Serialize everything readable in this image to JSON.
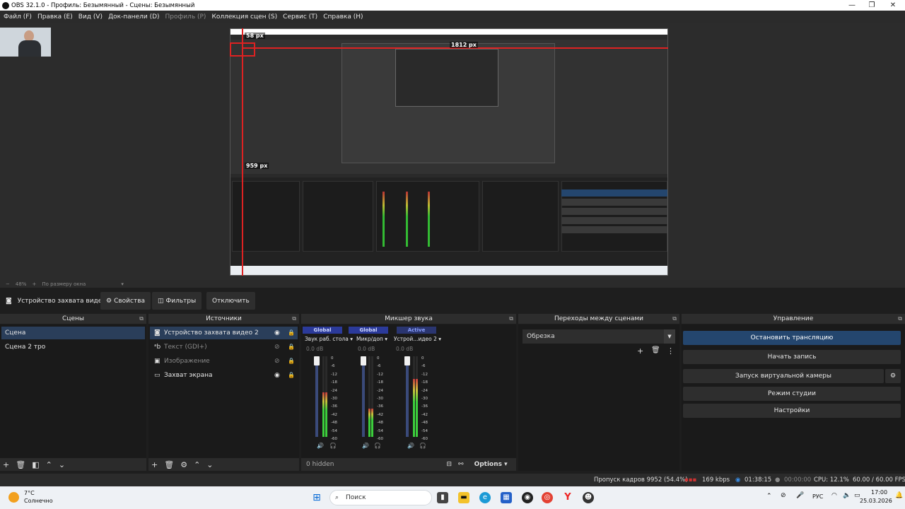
{
  "window": {
    "title": "OBS 32.1.0 - Профиль: Безымянный - Сцены: Безымянный"
  },
  "menu": [
    "Файл (F)",
    "Правка (E)",
    "Вид (V)",
    "Док-панели (D)",
    "Профиль (P)",
    "Коллекция сцен (S)",
    "Сервис (T)",
    "Справка (H)"
  ],
  "preview": {
    "label_top": "58 px",
    "label_right": "1812 px",
    "label_left": "959 px",
    "zoom": "48%",
    "zoom_mode": "По размеру окна"
  },
  "source_toolbar": {
    "source_name": "Устройство захвата видео",
    "properties": "Свойства",
    "filters": "Фильтры",
    "deactivate": "Отключить"
  },
  "scenes": {
    "title": "Сцены",
    "items": [
      "Сцена",
      "Сцена 2  тро"
    ]
  },
  "sources": {
    "title": "Источники",
    "items": [
      "Устройство захвата видео 2",
      "Текст (GDI+)",
      "Изображение",
      "Захват экрана"
    ]
  },
  "mixer": {
    "title": "Микшер звука",
    "channels": [
      {
        "badge": "Global",
        "name": "Звук раб. стола",
        "db": "0.0 dB",
        "level": 0.55
      },
      {
        "badge": "Global",
        "name": "Микр/доп",
        "db": "0.0 dB",
        "level": 0.35
      },
      {
        "badge": "Active",
        "name": "Устрой...идео 2",
        "db": "0.0 dB",
        "level": 0.72
      }
    ],
    "scale": [
      "0",
      "-6",
      "-12",
      "-18",
      "-24",
      "-30",
      "-36",
      "-42",
      "-48",
      "-54",
      "-60"
    ],
    "hidden": "0 hidden",
    "options": "Options"
  },
  "transitions": {
    "title": "Переходы между сценами",
    "selected": "Обрезка"
  },
  "controls": {
    "title": "Управление",
    "stop_stream": "Остановить трансляцию",
    "start_record": "Начать запись",
    "virtual_cam": "Запуск виртуальной камеры",
    "studio_mode": "Режим студии",
    "settings": "Настройки"
  },
  "status": {
    "dropped": "Пропуск кадров 9952 (54.4%)",
    "bitrate": "169 kbps",
    "stream_time": "01:38:15",
    "rec_time": "00:00:00",
    "cpu": "CPU: 12.1%",
    "fps": "60.00 / 60.00 FPS"
  },
  "taskbar": {
    "temp": "7°C",
    "weather": "Солнечно",
    "search": "Поиск",
    "lang": "РУС",
    "time": "17:00",
    "date": "25.03.2026"
  },
  "colors": {
    "accent_blue": "#2a3e5a",
    "active_button": "#24466e",
    "badge": "#2b3a9a",
    "guide_red": "#dd2222"
  }
}
